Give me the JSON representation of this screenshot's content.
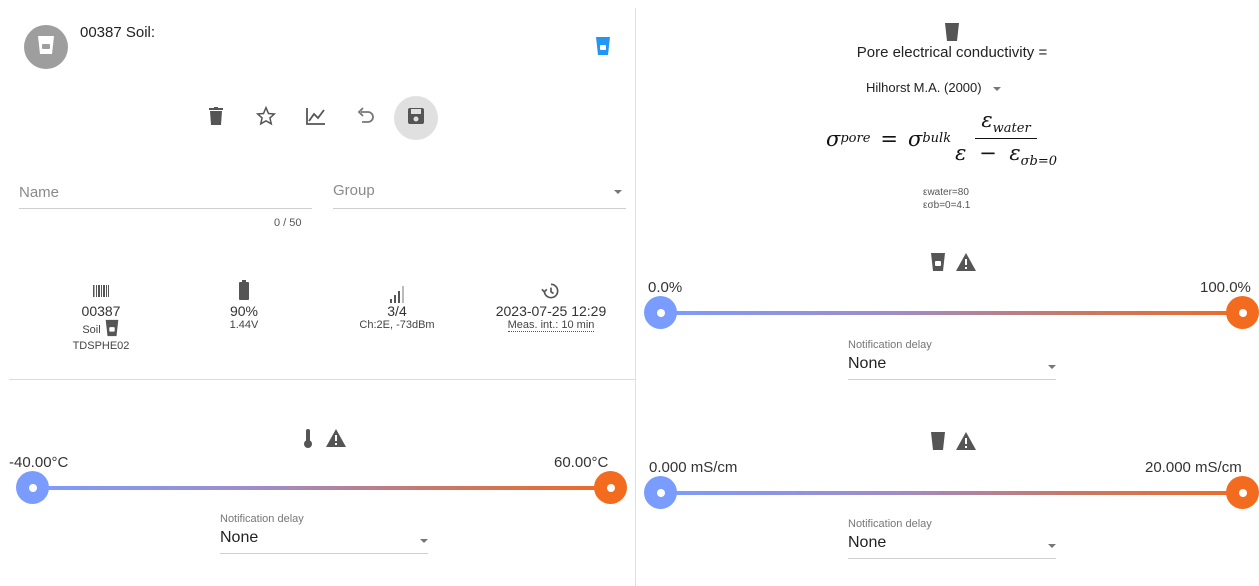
{
  "device": {
    "title": "00387 Soil:",
    "toolbar": [
      "delete",
      "favorite",
      "chart",
      "undo",
      "save"
    ]
  },
  "form": {
    "name_placeholder": "Name",
    "group_placeholder": "Group",
    "name_counter": "0 / 50"
  },
  "stats": {
    "id": {
      "value": "00387",
      "type": "Soil",
      "model": "TDSPHE02",
      "icon": "barcode-icon"
    },
    "battery": {
      "value": "90%",
      "sub": "1.44V",
      "icon": "battery-icon"
    },
    "signal": {
      "value": "3/4",
      "sub": "Ch:2E, -73dBm",
      "icon": "signal-icon"
    },
    "time": {
      "value": "2023-07-25 12:29",
      "sub": "Meas. int.: 10 min",
      "icon": "history-icon"
    }
  },
  "temperature": {
    "min": "-40.00°C",
    "max": "60.00°C",
    "notification_label": "Notification delay",
    "notification_value": "None"
  },
  "conductivity": {
    "title": "Pore electrical conductivity =",
    "model": "Hilhorst M.A. (2000)",
    "formula": {
      "sigma": "σ",
      "sub_pore": "pore",
      "equals": "=",
      "sub_bulk": "bulk",
      "epsilon": "ε",
      "sub_water": "water",
      "minus": "−",
      "sub_sb0": "σb=0"
    },
    "param_water": "εwater=80",
    "param_sb0": "εσb=0=4.1"
  },
  "moisture": {
    "min": "0.0%",
    "max": "100.0%",
    "notification_label": "Notification delay",
    "notification_value": "None"
  },
  "ec": {
    "min": "0.000 mS/cm",
    "max": "20.000 mS/cm",
    "notification_label": "Notification delay",
    "notification_value": "None"
  },
  "colors": {
    "accent_blue": "#2196f3",
    "slider_start": "#7b9cff",
    "slider_end": "#f26b1f",
    "icon_gray": "#555555"
  }
}
